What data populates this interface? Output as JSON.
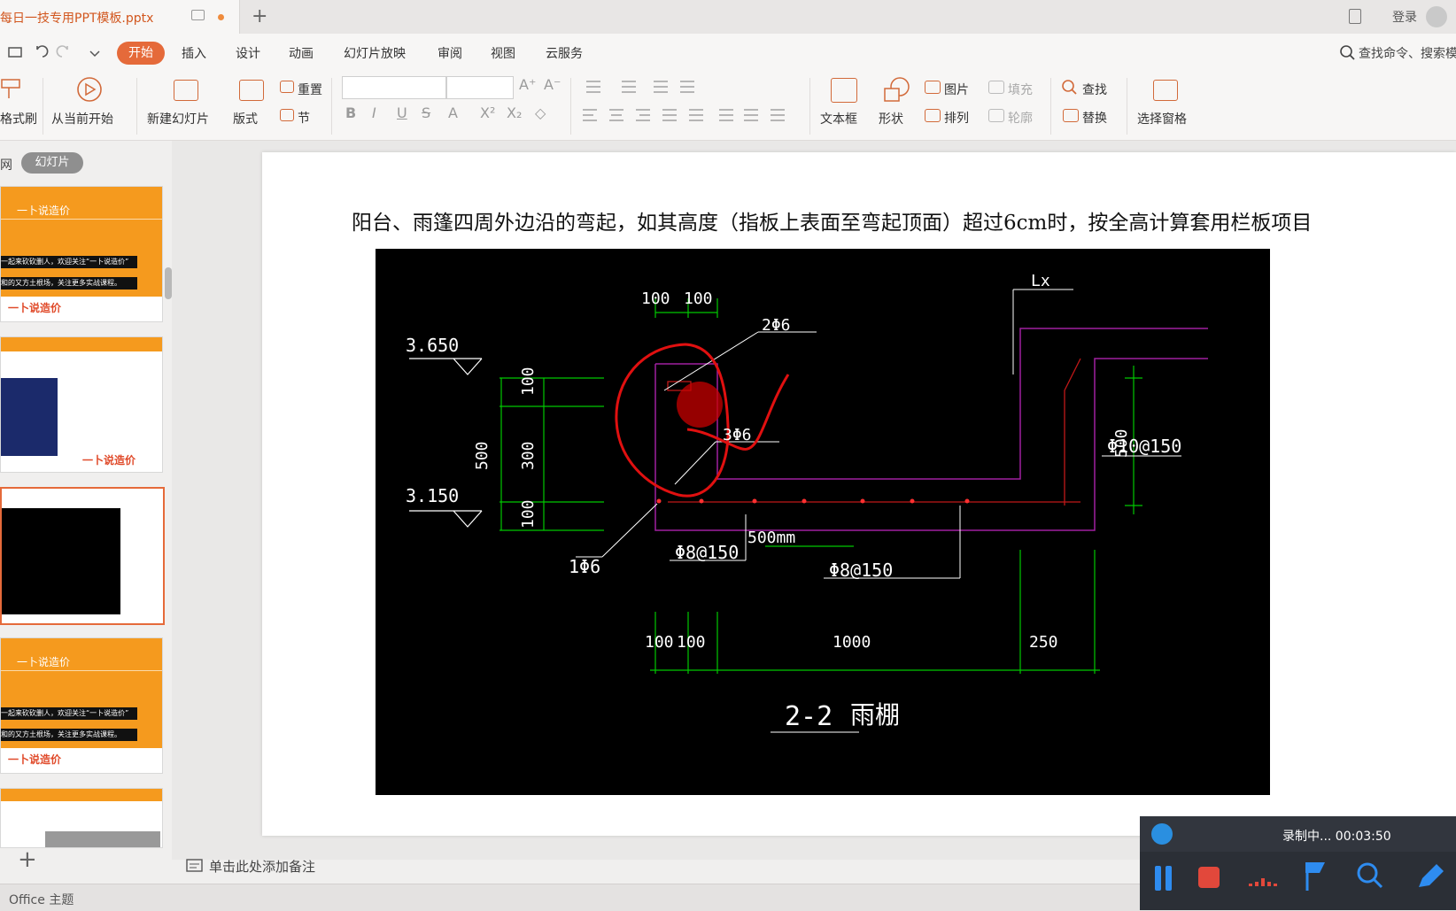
{
  "window": {
    "doc_tab": "每日一技专用PPT模板.pptx",
    "login": "登录"
  },
  "menu": {
    "start": "开始",
    "insert": "插入",
    "design": "设计",
    "animation": "动画",
    "slideshow": "幻灯片放映",
    "review": "审阅",
    "view": "视图",
    "cloud": "云服务",
    "search": "查找命令、搜索模"
  },
  "ribbon": {
    "format_painter": "格式刷",
    "play_from_current": "从当前开始",
    "new_slide": "新建幻灯片",
    "layout": "版式",
    "reset": "重置",
    "section": "节",
    "textbox": "文本框",
    "shape": "形状",
    "picture": "图片",
    "arrange": "排列",
    "fill": "填充",
    "outline": "轮廓",
    "find": "查找",
    "replace": "替换",
    "selection_pane": "选择窗格"
  },
  "pane": {
    "outline_tab": "网",
    "slides_tab": "幻灯片",
    "thumb_caption": "一卜说造价",
    "thumb_banner_1": "一起来砍砍删人，欢迎关注“一卜说造价”",
    "thumb_banner_2": "和的又方土根场，关注更多实战课程。",
    "thumb_logo": "一卜说造价"
  },
  "slide": {
    "heading": "阳台、雨篷四周外边沿的弯起，如其高度（指板上表面至弯起顶面）超过6cm时，按全高计算套用栏板项目"
  },
  "cad": {
    "dim_100a": "100",
    "dim_100b": "100",
    "rebar_2phi6": "2Φ6",
    "lx": "Lx",
    "elev_3650": "3.650",
    "elev_3150": "3.150",
    "dim_500": "500",
    "dim_100v1": "100",
    "dim_300": "300",
    "dim_100v2": "100",
    "rebar_3phi6": "3Φ6",
    "dim_500_right": "500",
    "rebar_phi10": "Φ10@150",
    "rebar_1phi6": "1Φ6",
    "dim_500mm": "500mm",
    "rebar_phi8a": "Φ8@150",
    "rebar_phi8b": "Φ8@150",
    "bot_100a": "100",
    "bot_100b": "100",
    "bot_1000": "1000",
    "bot_250": "250",
    "section": "2-2",
    "section_name": "雨棚"
  },
  "notes": {
    "placeholder": "单击此处添加备注"
  },
  "status": {
    "theme": "Office 主题"
  },
  "recorder": {
    "status": "录制中... 00:03:50"
  },
  "colors": {
    "accent": "#e56a3a",
    "orange": "#f59a1e",
    "cad_green": "#00c800",
    "cad_magenta": "#a020a0",
    "annotation_red": "#e01010"
  }
}
